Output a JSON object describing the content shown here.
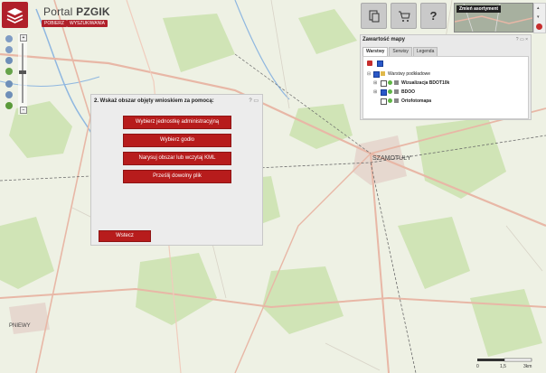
{
  "header": {
    "title_prefix": "Portal",
    "title_brand": "PZGIK",
    "menu": [
      "POBIERZ",
      "WYSZUKIWANIA"
    ]
  },
  "topbar": {
    "assortment_label": "Zmień asortyment"
  },
  "map_content": {
    "panel": {
      "title": "Zawartość mapy",
      "tabs": [
        "Warstwy",
        "Serwisy",
        "Legenda"
      ],
      "tree": {
        "root": "Warstwy podkładowe",
        "items": [
          "Wizualizacja BDOT10k",
          "BDOO",
          "Ortofotomapa"
        ]
      }
    }
  },
  "dialog": {
    "title": "2. Wskaż obszar objęty wnioskiem za pomocą:",
    "buttons": [
      "Wybierz jednostkę administracyjną",
      "Wybierz godło",
      "Narysuj obszar lub wczytaj KML",
      "Prześlij dowolny plik"
    ],
    "back": "Wstecz"
  },
  "map_labels": {
    "city": "SZAMOTUŁY",
    "town": "PNIEWY"
  },
  "scale": {
    "labels": [
      "0",
      "1,5",
      "3km"
    ]
  },
  "colors": {
    "brand_red": "#b71c1c",
    "map_bg": "#eef1e4",
    "forest": "#cfe3b4",
    "road": "#e8b7a6",
    "river": "#8fb7e0"
  }
}
